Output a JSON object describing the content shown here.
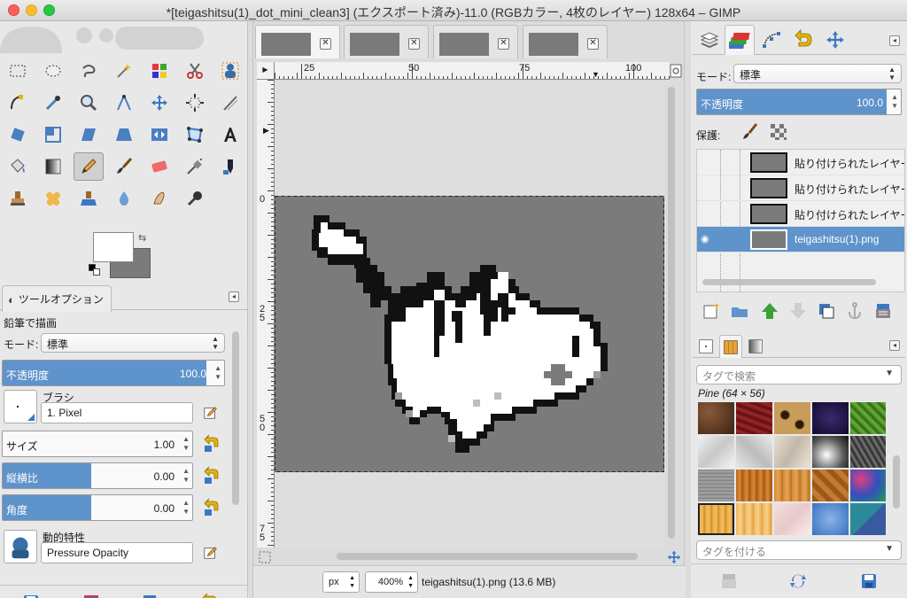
{
  "window": {
    "title": "*[teigashitsu(1)_dot_mini_clean3] (エクスポート済み)-11.0 (RGBカラー, 4枚のレイヤー) 128x64 – GIMP"
  },
  "toolbox": {
    "tool_options_tab": "ツールオプション",
    "tool_options": {
      "heading": "鉛筆で描画",
      "mode_label": "モード:",
      "mode_value": "標準",
      "opacity_label": "不透明度",
      "opacity_value": "100.0",
      "brush_label": "ブラシ",
      "brush_value": "1. Pixel",
      "size_label": "サイズ",
      "size_value": "1.00",
      "aspect_label": "縦横比",
      "aspect_value": "0.00",
      "angle_label": "角度",
      "angle_value": "0.00",
      "dynamics_label": "動的特性",
      "dynamics_value": "Pressure Opacity"
    },
    "colors": {
      "foreground": "#ffffff",
      "background": "#7b7b7b"
    }
  },
  "canvas": {
    "image_tabs": [
      "image-tab-1",
      "image-tab-2",
      "image-tab-3",
      "image-tab-4"
    ],
    "ruler_h_labels": [
      "25",
      "50",
      "75",
      "100"
    ],
    "ruler_v_labels": [
      "0",
      "25",
      "50",
      "75"
    ],
    "unit": "px",
    "zoom": "400",
    "zoom_unit": "%",
    "status": "teigashitsu(1).png (13.6 MB)"
  },
  "layers": {
    "mode_label": "モード:",
    "mode_value": "標準",
    "opacity_label": "不透明度",
    "opacity_value": "100.0",
    "lock_label": "保護:",
    "items": [
      {
        "name": "貼り付けられたレイヤー",
        "selected": false
      },
      {
        "name": "貼り付けられたレイヤー",
        "selected": false
      },
      {
        "name": "貼り付けられたレイヤー",
        "selected": false
      },
      {
        "name": "teigashitsu(1).png",
        "selected": true
      }
    ]
  },
  "patterns": {
    "search_placeholder": "タグで検索",
    "pattern_label": "Pine (64 × 56)",
    "tag_placeholder": "タグを付ける"
  }
}
